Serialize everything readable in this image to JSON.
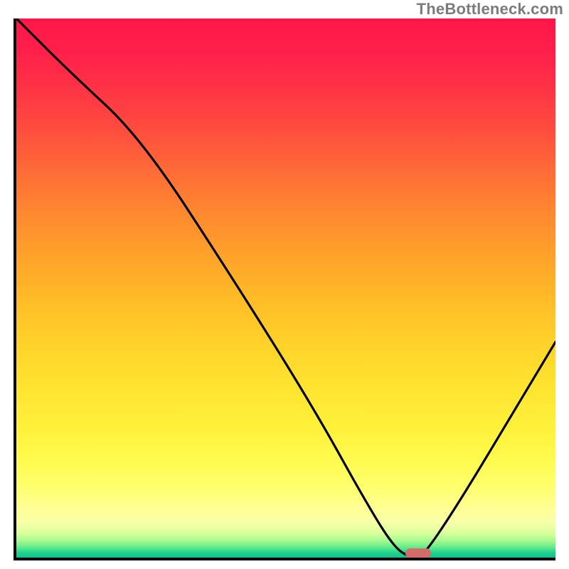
{
  "watermark": "TheBottleneck.com",
  "chart_data": {
    "type": "line",
    "title": "",
    "xlabel": "",
    "ylabel": "",
    "xlim": [
      0,
      100
    ],
    "ylim": [
      0,
      100
    ],
    "grid": false,
    "series": [
      {
        "name": "curve",
        "x": [
          0,
          10,
          23,
          40,
          55,
          65,
          70,
          73,
          76,
          100
        ],
        "y": [
          100,
          90,
          78,
          52,
          28,
          10,
          2,
          0,
          0,
          40
        ]
      }
    ],
    "marker": {
      "x": 74.5,
      "y": 0.8,
      "color": "#d46a6a"
    },
    "gradient_stops": [
      {
        "pct": 0,
        "color": "#ff1749"
      },
      {
        "pct": 50,
        "color": "#ffc428"
      },
      {
        "pct": 90,
        "color": "#ffff80"
      },
      {
        "pct": 100,
        "color": "#0fc18c"
      }
    ]
  }
}
